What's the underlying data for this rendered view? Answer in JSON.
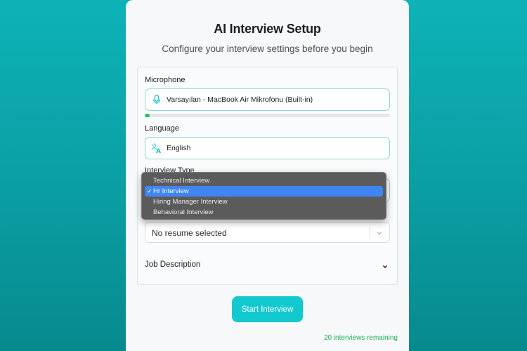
{
  "card": {
    "title": "AI Interview Setup",
    "subtitle": "Configure your interview settings before you begin"
  },
  "microphone": {
    "label": "Microphone",
    "value": "Varsayılan - MacBook Air Mikrofonu (Built-in)",
    "icon": "microphone-icon",
    "level": 0.02
  },
  "language": {
    "label": "Language",
    "value": "English",
    "icon": "translate-icon"
  },
  "interview_type": {
    "label": "Interview Type",
    "options": [
      "Technical Interview",
      "Hr Interview",
      "Hiring Manager Interview",
      "Behavioral Interview"
    ],
    "selected": "Hr Interview"
  },
  "resume": {
    "value": "No resume selected"
  },
  "job_description": {
    "label": "Job Description"
  },
  "actions": {
    "start_label": "Start Interview"
  },
  "footer": {
    "remaining": "20 interviews remaining"
  },
  "colors": {
    "accent": "#12c9cf",
    "success": "#22c55e",
    "selected_option": "#3f86f3"
  }
}
